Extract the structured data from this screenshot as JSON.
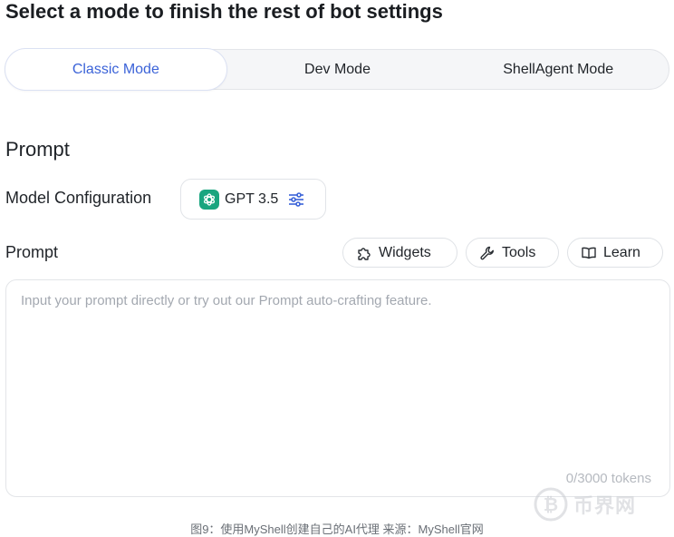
{
  "header": {
    "title": "Select a mode to finish the rest of bot settings"
  },
  "modes": [
    {
      "label": "Classic Mode",
      "active": true
    },
    {
      "label": "Dev Mode",
      "active": false
    },
    {
      "label": "ShellAgent Mode",
      "active": false
    }
  ],
  "section": {
    "title": "Prompt"
  },
  "model_config": {
    "label": "Model Configuration",
    "model": "GPT 3.5",
    "icon": "sliders-icon"
  },
  "prompt": {
    "label": "Prompt",
    "placeholder": "Input your prompt directly or try out our Prompt auto-crafting feature.",
    "value": "",
    "token_count": "0/3000 tokens",
    "buttons": [
      {
        "label": "Widgets",
        "icon": "puzzle-icon"
      },
      {
        "label": "Tools",
        "icon": "wrench-icon"
      },
      {
        "label": "Learn",
        "icon": "book-icon"
      }
    ]
  },
  "caption": "图9：使用MyShell创建自己的AI代理 来源：MyShell官网",
  "watermark": {
    "text": "币界网"
  },
  "colors": {
    "accent": "#3b63d8",
    "gpt_green": "#19a57f"
  }
}
